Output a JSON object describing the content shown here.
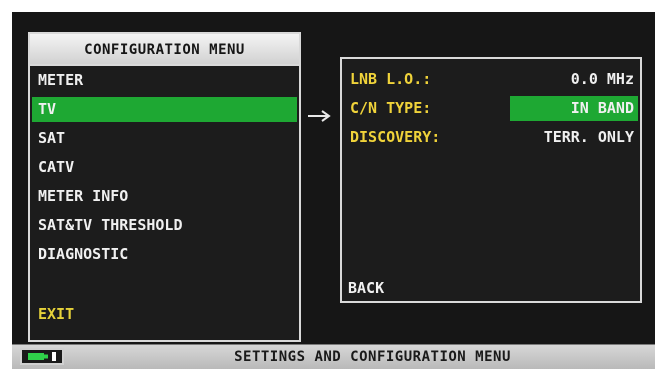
{
  "config_menu": {
    "title": "CONFIGURATION MENU",
    "items": [
      {
        "label": "METER",
        "selected": false
      },
      {
        "label": "TV",
        "selected": true
      },
      {
        "label": "SAT",
        "selected": false
      },
      {
        "label": "CATV",
        "selected": false
      },
      {
        "label": "METER INFO",
        "selected": false
      },
      {
        "label": "SAT&TV THRESHOLD",
        "selected": false
      },
      {
        "label": "DIAGNOSTIC",
        "selected": false
      }
    ],
    "exit_label": "EXIT"
  },
  "tv_settings": {
    "params": [
      {
        "label": "LNB L.O.:",
        "value": "0.0 MHz",
        "selected": false
      },
      {
        "label": "C/N TYPE:",
        "value": "IN BAND",
        "selected": true
      },
      {
        "label": "DISCOVERY:",
        "value": "TERR. ONLY",
        "selected": false
      }
    ],
    "back_label": "BACK"
  },
  "status_bar": {
    "text": "SETTINGS AND CONFIGURATION MENU",
    "battery_icon": "battery-icon"
  },
  "colors": {
    "selection": "#1ea833",
    "highlight_text": "#f0d33a",
    "screen_bg": "#161616"
  }
}
